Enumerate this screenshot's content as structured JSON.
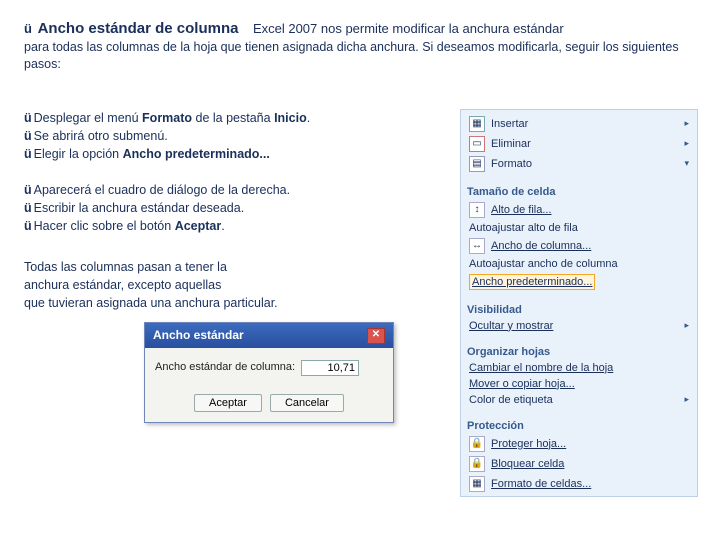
{
  "heading": {
    "check": "ü",
    "title": "Ancho estándar de columna",
    "lead": "Excel 2007 nos permite modificar la anchura estándar",
    "para_rest": "para todas las columnas de la hoja que tienen asignada dicha anchura. Si deseamos modificarla, seguir los siguientes pasos:"
  },
  "steps1": {
    "c1": "ü",
    "t1_a": "Desplegar el menú ",
    "t1_b": "Formato",
    "t1_c": " de la pestaña ",
    "t1_d": "Inicio",
    "t1_e": ".",
    "c2": "ü",
    "t2": "Se abrirá otro submenú.",
    "c3": "ü",
    "t3_a": "Elegir la opción ",
    "t3_b": "Ancho predeterminado..."
  },
  "steps2": {
    "c1": "ü",
    "t1": "Aparecerá el cuadro de diálogo de la derecha.",
    "c2": "ü",
    "t2": "Escribir la anchura estándar deseada.",
    "c3": "ü",
    "t3_a": "Hacer clic sobre el botón ",
    "t3_b": "Aceptar",
    "t3_c": "."
  },
  "note": {
    "l1": "Todas las columnas pasan a tener la",
    "l2": " anchura  estándar, excepto aquellas",
    "l3": "que tuvieran asignada una anchura particular."
  },
  "panel": {
    "insertar": "Insertar",
    "eliminar": "Eliminar",
    "formato": "Formato",
    "g1": "Tamaño de celda",
    "i1": "Alto de fila...",
    "i2": "Autoajustar alto de fila",
    "i3": "Ancho de columna...",
    "i4": "Autoajustar ancho de columna",
    "i5": "Ancho predeterminado...",
    "g2": "Visibilidad",
    "i6": "Ocultar y mostrar",
    "g3": "Organizar hojas",
    "i7": "Cambiar el nombre de la hoja",
    "i8": "Mover o copiar hoja...",
    "i9": "Color de etiqueta",
    "g4": "Protección",
    "i10": "Proteger hoja...",
    "i11": "Bloquear celda",
    "i12": "Formato de celdas..."
  },
  "dialog": {
    "title": "Ancho estándar",
    "label": "Ancho estándar de columna:",
    "value": "10,71",
    "ok": "Aceptar",
    "cancel": "Cancelar"
  }
}
